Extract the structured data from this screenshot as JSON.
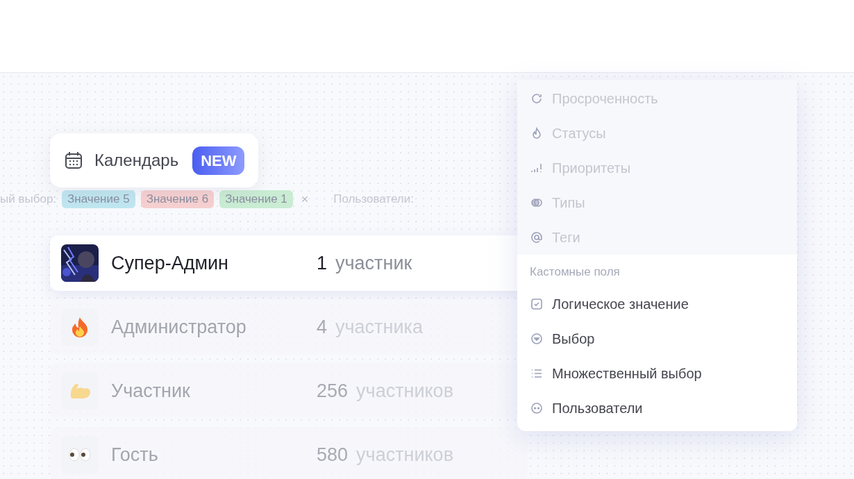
{
  "calendar_card": {
    "label": "Календарь",
    "badge": "NEW"
  },
  "filter_bar": {
    "label": "ый выбор:",
    "tags": [
      {
        "text": "Значение 5",
        "color": "#bfe6f0"
      },
      {
        "text": "Значение 6",
        "color": "#f6d0d0"
      },
      {
        "text": "Значение 1",
        "color": "#c9ecd3"
      }
    ],
    "clear": "×",
    "next_label": "Пользователи:"
  },
  "roles": [
    {
      "kind": "picture",
      "name": "Супер-Админ",
      "count": "1",
      "unit": "участник",
      "selected": true
    },
    {
      "kind": "fire",
      "name": "Администратор",
      "count": "4",
      "unit": "участника",
      "selected": false
    },
    {
      "kind": "arm",
      "name": "Участник",
      "count": "256",
      "unit": "участников",
      "selected": false
    },
    {
      "kind": "eyes",
      "name": "Гость",
      "count": "580",
      "unit": "участников",
      "selected": false
    }
  ],
  "menu": {
    "items": [
      {
        "kind": "overdue",
        "label": "Просроченность",
        "disabled": true
      },
      {
        "kind": "status",
        "label": "Статусы",
        "disabled": true
      },
      {
        "kind": "priority",
        "label": "Приоритеты",
        "disabled": true
      },
      {
        "kind": "type",
        "label": "Типы",
        "disabled": true
      },
      {
        "kind": "tag",
        "label": "Теги",
        "disabled": true
      }
    ],
    "section_title": "Кастомные поля",
    "custom_items": [
      {
        "kind": "boolean",
        "label": "Логическое значение",
        "disabled": false
      },
      {
        "kind": "select",
        "label": "Выбор",
        "disabled": false
      },
      {
        "kind": "multiselect",
        "label": "Множественный выбор",
        "disabled": false
      },
      {
        "kind": "users",
        "label": "Пользователи",
        "disabled": false
      }
    ]
  }
}
